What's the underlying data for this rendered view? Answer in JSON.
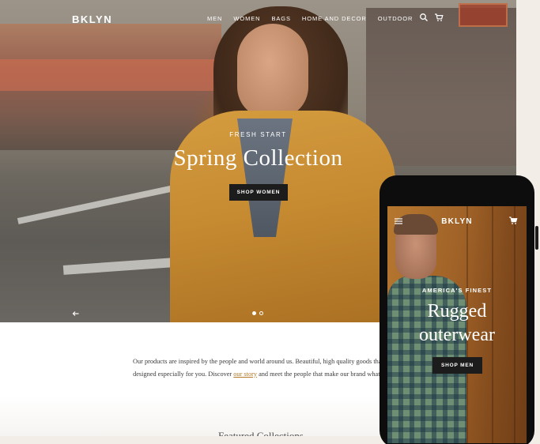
{
  "desktop": {
    "logo": "BKLYN",
    "nav": [
      "MEN",
      "WOMEN",
      "BAGS",
      "HOME AND DECOR",
      "OUTDOOR"
    ],
    "hero": {
      "kicker": "FRESH START",
      "title": "Spring Collection",
      "cta": "SHOP WOMEN",
      "slide_index": 1,
      "slide_count": 2
    },
    "intro": {
      "part1": "Our products are inspired by the people and world around us. Beautiful, high quality goods that are designed especially for you. Discover ",
      "link": "our story",
      "part2": " and meet the people that make our brand what it is."
    },
    "featured_title": "Featured Collections"
  },
  "mobile": {
    "logo": "BKLYN",
    "hero": {
      "kicker": "AMERICA'S FINEST",
      "title_line1": "Rugged",
      "title_line2": "outerwear",
      "cta": "SHOP MEN"
    }
  },
  "icons": [
    "search-icon",
    "cart-icon",
    "arrow-left-icon",
    "hamburger-menu-icon"
  ],
  "colors": {
    "cta_bg": "#1c1c1c",
    "link": "#b67a2a",
    "page_bg": "#f2ede6"
  }
}
